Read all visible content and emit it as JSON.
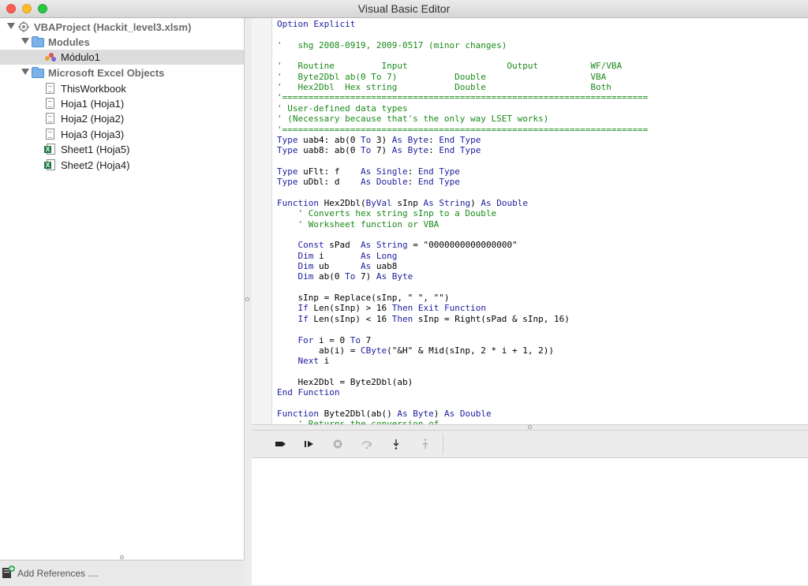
{
  "window": {
    "title": "Visual Basic Editor"
  },
  "project_tree": {
    "items": [
      {
        "label": "VBAProject (Hackit_level3.xlsm)",
        "icon": "vba-project-icon"
      },
      {
        "label": "Modules",
        "icon": "folder-icon"
      },
      {
        "label": "Módulo1",
        "icon": "module-icon"
      },
      {
        "label": "Microsoft Excel Objects",
        "icon": "folder-icon"
      },
      {
        "label": "ThisWorkbook",
        "icon": "workbook-doc-icon"
      },
      {
        "label": "Hoja1 (Hoja1)",
        "icon": "sheet-doc-icon"
      },
      {
        "label": "Hoja2 (Hoja2)",
        "icon": "sheet-doc-icon"
      },
      {
        "label": "Hoja3 (Hoja3)",
        "icon": "sheet-doc-icon"
      },
      {
        "label": "Sheet1 (Hoja5)",
        "icon": "excel-sheet-icon"
      },
      {
        "label": "Sheet2 (Hoja4)",
        "icon": "excel-sheet-icon"
      }
    ],
    "selected": "Módulo1",
    "add_references_label": "Add References ...."
  },
  "code": {
    "lines": [
      "Option Explicit",
      "",
      "'   shg 2008-0919, 2009-0517 (minor changes)",
      "",
      "'   Routine         Input                   Output          WF/VBA",
      "'   Byte2Dbl ab(0 To 7)           Double                    VBA",
      "'   Hex2Dbl  Hex string           Double                    Both",
      "'======================================================================",
      "' User-defined data types",
      "' (Necessary because that's the only way LSET works)",
      "'======================================================================",
      "Type uab4: ab(0 To 3) As Byte: End Type",
      "Type uab8: ab(0 To 7) As Byte: End Type",
      "",
      "Type uFlt: f    As Single: End Type",
      "Type uDbl: d    As Double: End Type",
      "",
      "Function Hex2Dbl(ByVal sInp As String) As Double",
      "    ' Converts hex string sInp to a Double",
      "    ' Worksheet function or VBA",
      "",
      "    Const sPad  As String = \"0000000000000000\"",
      "    Dim i       As Long",
      "    Dim ub      As uab8",
      "    Dim ab(0 To 7) As Byte",
      "",
      "    sInp = Replace(sInp, \" \", \"\")",
      "    If Len(sInp) > 16 Then Exit Function",
      "    If Len(sInp) < 16 Then sInp = Right(sPad & sInp, 16)",
      "",
      "    For i = 0 To 7",
      "        ab(i) = CByte(\"&H\" & Mid(sInp, 2 * i + 1, 2))",
      "    Next i",
      "",
      "    Hex2Dbl = Byte2Dbl(ab)",
      "End Function",
      "",
      "Function Byte2Dbl(ab() As Byte) As Double",
      "    ' Returns the conversion of"
    ]
  },
  "debug_toolbar": {
    "buttons": [
      "run-icon",
      "step-run-icon",
      "stop-icon",
      "step-over-icon",
      "step-into-icon",
      "step-out-icon"
    ]
  },
  "colors": {
    "keyword": "#1c1c9e",
    "comment": "#1a8a1a",
    "selection": "#dcdcdc"
  }
}
